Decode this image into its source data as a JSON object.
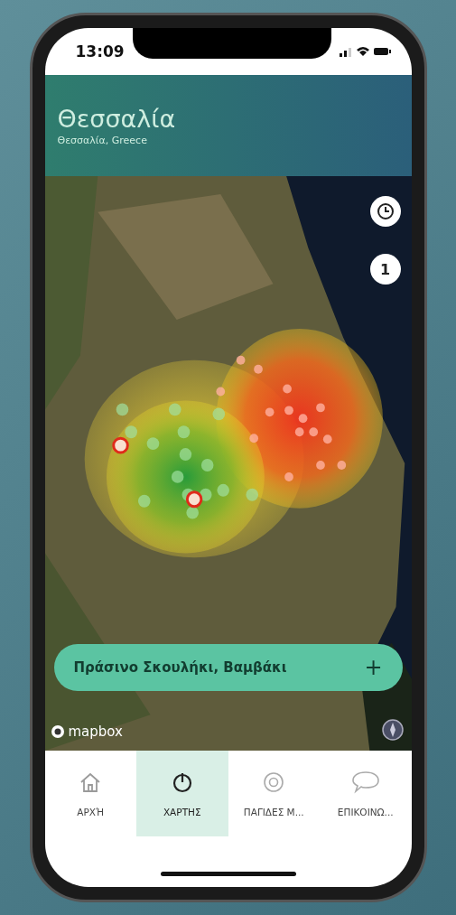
{
  "status_bar": {
    "time": "13:09"
  },
  "header": {
    "title": "Θεσσαλία",
    "subtitle": "Θεσσαλία, Greece"
  },
  "map": {
    "layer_count": "1",
    "filter_chip": {
      "label": "Πράσινο Σκουλήκι, Βαμβάκι",
      "action": "+"
    },
    "attribution": "mapbox"
  },
  "tabs": [
    {
      "label": "ΑΡΧΉ",
      "kind": "home",
      "selected": false
    },
    {
      "label": "ΧΑΡΤΗΣ",
      "kind": "map",
      "selected": true
    },
    {
      "label": "ΠΑΓΙΔΕΣ Μ...",
      "kind": "traps",
      "selected": false
    },
    {
      "label": "ΕΠΙΚΟΙΝΩ...",
      "kind": "chat",
      "selected": false
    }
  ]
}
